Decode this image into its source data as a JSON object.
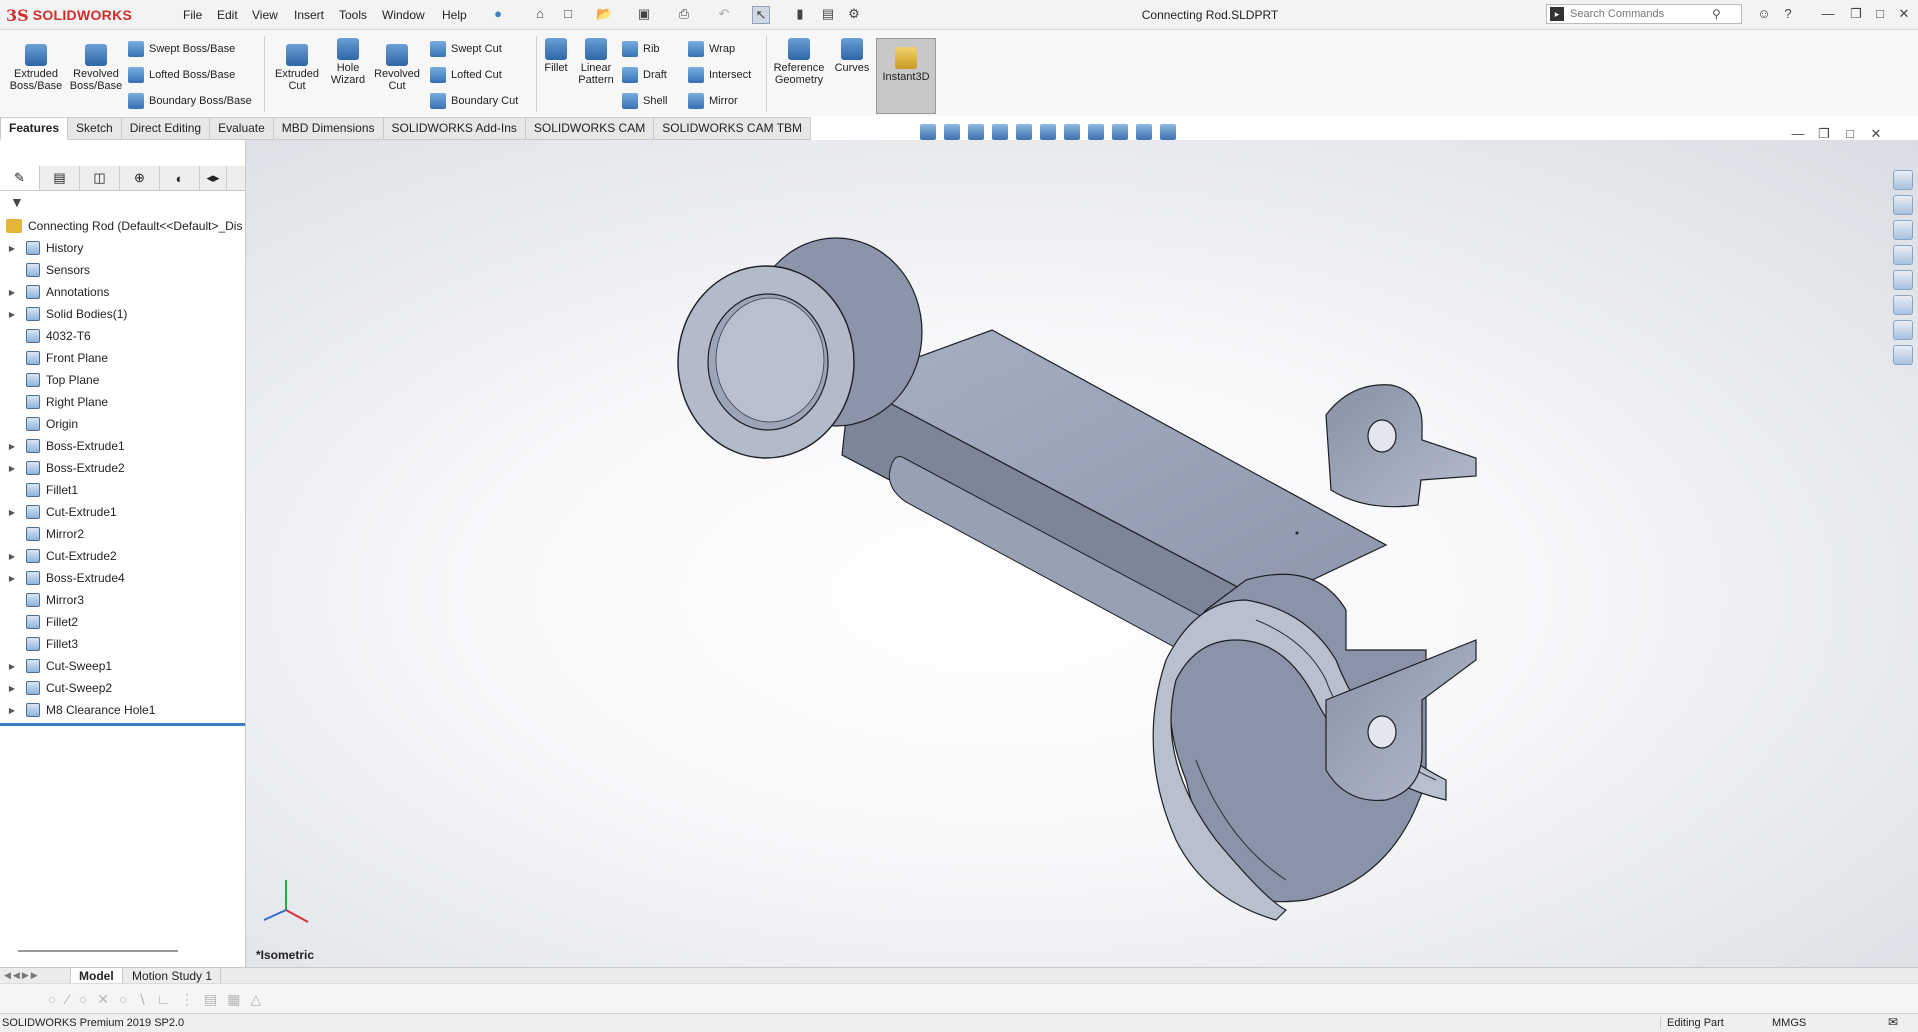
{
  "app": {
    "brand_prefix": "3S",
    "brand": "SOLIDWORKS",
    "document_title": "Connecting Rod.SLDPRT"
  },
  "menu": [
    "File",
    "Edit",
    "View",
    "Insert",
    "Tools",
    "Window",
    "Help"
  ],
  "search": {
    "placeholder": "Search Commands"
  },
  "ribbon": {
    "extruded_boss": "Extruded Boss/Base",
    "revolved_boss": "Revolved Boss/Base",
    "swept_boss": "Swept Boss/Base",
    "lofted_boss": "Lofted Boss/Base",
    "boundary_boss": "Boundary Boss/Base",
    "extruded_cut": "Extruded Cut",
    "hole_wizard": "Hole Wizard",
    "revolved_cut": "Revolved Cut",
    "swept_cut": "Swept Cut",
    "lofted_cut": "Lofted Cut",
    "boundary_cut": "Boundary Cut",
    "fillet": "Fillet",
    "linear_pattern": "Linear Pattern",
    "rib": "Rib",
    "draft": "Draft",
    "shell": "Shell",
    "wrap": "Wrap",
    "intersect": "Intersect",
    "mirror": "Mirror",
    "reference_geometry": "Reference Geometry",
    "curves": "Curves",
    "instant3d": "Instant3D"
  },
  "tabs": [
    "Features",
    "Sketch",
    "Direct Editing",
    "Evaluate",
    "MBD Dimensions",
    "SOLIDWORKS Add-Ins",
    "SOLIDWORKS CAM",
    "SOLIDWORKS CAM TBM"
  ],
  "tree": {
    "root": "Connecting Rod  (Default<<Default>_Dis",
    "items": [
      {
        "label": "History",
        "expandable": true
      },
      {
        "label": "Sensors",
        "expandable": false
      },
      {
        "label": "Annotations",
        "expandable": true
      },
      {
        "label": "Solid Bodies(1)",
        "expandable": true
      },
      {
        "label": "4032-T6",
        "expandable": false
      },
      {
        "label": "Front Plane",
        "expandable": false
      },
      {
        "label": "Top Plane",
        "expandable": false
      },
      {
        "label": "Right Plane",
        "expandable": false
      },
      {
        "label": "Origin",
        "expandable": false
      },
      {
        "label": "Boss-Extrude1",
        "expandable": true
      },
      {
        "label": "Boss-Extrude2",
        "expandable": true
      },
      {
        "label": "Fillet1",
        "expandable": false
      },
      {
        "label": "Cut-Extrude1",
        "expandable": true
      },
      {
        "label": "Mirror2",
        "expandable": false
      },
      {
        "label": "Cut-Extrude2",
        "expandable": true
      },
      {
        "label": "Boss-Extrude4",
        "expandable": true
      },
      {
        "label": "Mirror3",
        "expandable": false
      },
      {
        "label": "Fillet2",
        "expandable": false
      },
      {
        "label": "Fillet3",
        "expandable": false
      },
      {
        "label": "Cut-Sweep1",
        "expandable": true
      },
      {
        "label": "Cut-Sweep2",
        "expandable": true
      },
      {
        "label": "M8 Clearance Hole1",
        "expandable": true
      }
    ]
  },
  "viewport": {
    "view_name": "*Isometric"
  },
  "model_tabs": [
    "Model",
    "Motion Study 1"
  ],
  "status": {
    "product": "SOLIDWORKS Premium 2019 SP2.0",
    "mode": "Editing Part",
    "units": "MMGS"
  },
  "colors": {
    "accent": "#d12d2a",
    "selection": "#3c7fc4",
    "part_fill": "#a9b2c4"
  }
}
